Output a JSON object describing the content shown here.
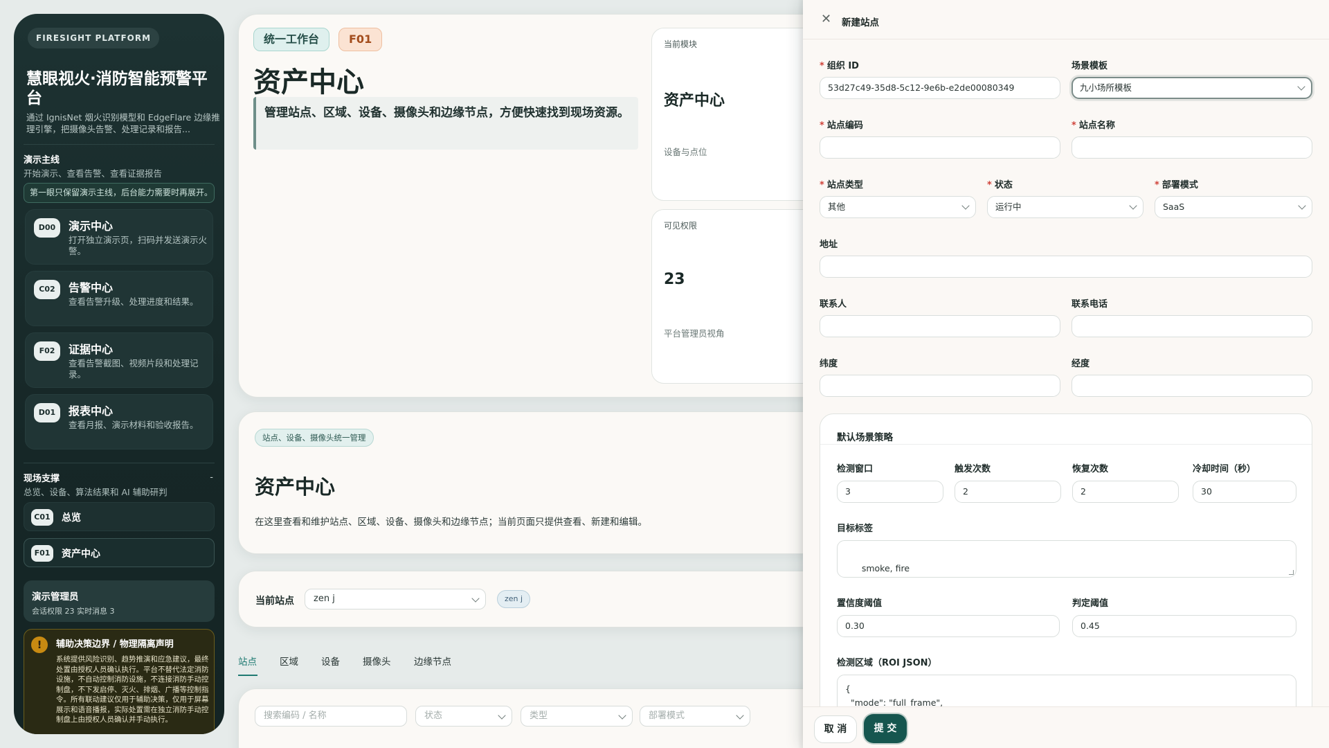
{
  "sidebar": {
    "platform_tag": "FIRESIGHT PLATFORM",
    "title": "慧眼视火·消防智能预警平台",
    "description": "通过 IgnisNet 烟火识别模型和 EdgeFlare 边缘推理引擎，把摄像头告警、处理记录和报告...",
    "demo_section": {
      "title": "演示主线",
      "subtitle": "开始演示、查看告警、查看证据报告",
      "notice": "第一眼只保留演示主线，后台能力需要时再展开。",
      "items": [
        {
          "code": "D00",
          "title": "演示中心",
          "desc": "打开独立演示页，扫码并发送演示火警。"
        },
        {
          "code": "C02",
          "title": "告警中心",
          "desc": "查看告警升级、处理进度和结果。"
        },
        {
          "code": "F02",
          "title": "证据中心",
          "desc": "查看告警截图、视频片段和处理记录。"
        },
        {
          "code": "D01",
          "title": "报表中心",
          "desc": "查看月报、演示材料和验收报告。"
        }
      ]
    },
    "field_section": {
      "title": "现场支撑",
      "collapse": "-",
      "subtitle": "总览、设备、算法结果和 AI 辅助研判",
      "items": [
        {
          "code": "C01",
          "label": "总览"
        },
        {
          "code": "F01",
          "label": "资产中心"
        }
      ]
    },
    "user": {
      "name": "演示管理员",
      "meta": "会话权限 23   实时消息 3"
    },
    "warning": {
      "icon": "!",
      "title": "辅助决策边界 / 物理隔离声明",
      "text": "系统提供风险识别、趋势推演和应急建议，最终处置由授权人员确认执行。平台不替代法定消防设施，不自动控制消防设施，不连接消防手动控制盘，不下发启停、灭火、排烟、广播等控制指令。所有联动建议仅用于辅助决策，仅用于屏幕展示和语音播报，实际处置需在独立消防手动控制盘上由授权人员确认并手动执行。"
    }
  },
  "header": {
    "chip_workbench": "统一工作台",
    "chip_code": "F01",
    "title": "资产中心",
    "description": "管理站点、区域、设备、摄像头和边缘节点，方便快速找到现场资源。",
    "cards": [
      {
        "label": "当前模块",
        "value": "资产中心",
        "sub": "设备与点位"
      },
      {
        "label": "可见权限",
        "value": "23",
        "sub": "平台管理员视角"
      }
    ]
  },
  "section": {
    "tag": "站点、设备、摄像头统一管理",
    "title": "资产中心",
    "description": "在这里查看和维护站点、区域、设备、摄像头和边缘节点；当前页面只提供查看、新建和编辑。"
  },
  "site_filter": {
    "label": "当前站点",
    "value": "zen j",
    "chip": "zen j"
  },
  "tabs": [
    "站点",
    "区域",
    "设备",
    "摄像头",
    "边缘节点"
  ],
  "list_filters": {
    "search_placeholder": "搜索编码 / 名称",
    "status_placeholder": "状态",
    "type_placeholder": "类型",
    "mode_placeholder": "部署模式"
  },
  "drawer": {
    "title": "新建站点",
    "close_icon": "close-icon",
    "fields": {
      "org_id": {
        "label": "组织 ID",
        "value": "53d27c49-35d8-5c12-9e6b-e2de00080349"
      },
      "scene_template": {
        "label": "场景模板",
        "value": "九小场所模板"
      },
      "site_code": {
        "label": "站点编码",
        "value": ""
      },
      "site_name": {
        "label": "站点名称",
        "value": ""
      },
      "site_type": {
        "label": "站点类型",
        "value": "其他"
      },
      "status": {
        "label": "状态",
        "value": "运行中"
      },
      "deploy_mode": {
        "label": "部署模式",
        "value": "SaaS"
      },
      "address": {
        "label": "地址",
        "value": ""
      },
      "contact": {
        "label": "联系人",
        "value": ""
      },
      "phone": {
        "label": "联系电话",
        "value": ""
      },
      "latitude": {
        "label": "纬度",
        "value": ""
      },
      "longitude": {
        "label": "经度",
        "value": ""
      }
    },
    "strategy": {
      "title": "默认场景策略",
      "window": {
        "label": "检测窗口",
        "value": "3"
      },
      "trigger": {
        "label": "触发次数",
        "value": "2"
      },
      "recover": {
        "label": "恢复次数",
        "value": "2"
      },
      "cooldown": {
        "label": "冷却时间（秒）",
        "value": "30"
      },
      "target_tags": {
        "label": "目标标签",
        "value": "smoke, fire"
      },
      "confidence": {
        "label": "置信度阈值",
        "value": "0.30"
      },
      "judge": {
        "label": "判定阈值",
        "value": "0.45"
      },
      "roi": {
        "label": "检测区域（ROI JSON）",
        "value": "{\n  \"mode\": \"full_frame\","
      }
    },
    "cancel_label": "取 消",
    "submit_label": "提 交"
  }
}
